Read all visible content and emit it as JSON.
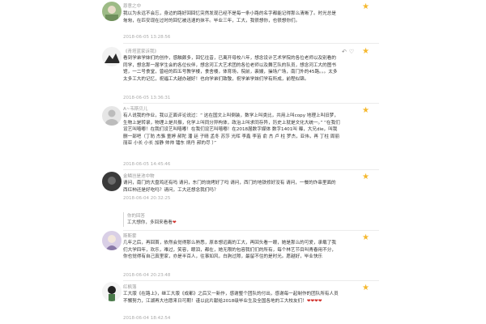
{
  "comments": [
    {
      "user": "恩意之中",
      "text": "我以为永远不会忘，身边的路好回回忆突然发现已经不是每一条小路的名字都能记得那么清晰了。时光总是匆匆，在匹安现在过时的回忆被迅速的抹平。毕业三年，工大，我很想你，也很想你们。",
      "time": "2018-06-05 13:28:56"
    },
    {
      "user": "《青塔蓝家诉我》",
      "text": "看到学弟学妹们的创作，感触颇多，回忆往昔，已离开母校八年，想念设计艺术学院的各位老师以及别看的同学，想念那一届学生会的各位伙伴，想念河工大艺术团的各位老师以及舞艺队的队员，想念河工大的图书馆，一二号食堂，曾经的四五号教学楼，食舍楼，体育场，院前，裴嫂，操场广场，南门外的45路。。。太多太多工大的记忆，祝福工大越办越好！也向学弟们致敬，祝学弟学妹们学有所成，前程似锦。",
      "time": "2018-06-05 13:36:31"
    },
    {
      "user": "A~韦斯贝儿",
      "text": "有人说我的作业，我以正面评论说过：“ 这在国文上叫倒装，数学上叫类比，共用上叫copy 地理上叫旧梦，生物上是转录，物理上是共振，化学上叫同分异构体，政治上叫求同存异，历史上就是文化大统一。” “在我们设艺叫嘻嘟！在我们设艺叫嘻嘟！在我们设艺叫嘻嘟！在2018届数字媒体 数字1401叫 曝，大兄die，叫我删一部吧（丁昉 杰骆 童婷 郝陀 潘 廷 子晴 孟冬 苏莎 光晖 李鑫 李苗 俞 杰 卢 柱 罗杰，亚伟，再 丁柱 周丽 丽亚 小长 小长 加静 帅帅 镭东 炳丹 郝的尽 ）”",
      "time": "2018-06-05 14:45:46"
    },
    {
      "user": "金鳞岂是池中物",
      "text": "请问，南门的大盘鸡还有吗 请问，东门的烧烤好了吗 请问，西门的地铁修好没有 请问，一餐的炸串里面的西红柿还是好吃吗？请问，工大还想念我们吗？",
      "time": "2018-06-04 20:32:25",
      "reply_name": "你的回答",
      "reply_text": "工大想你，多回来看看",
      "reply_heart": "❤"
    },
    {
      "user": "斯斯雾",
      "text": "几年之后，再回首，依然会觉得那么熟悉，原本想远离的工大，再回头看一眼，她是那么的可爱，承载了我们大学四年，欢乐，难过，笑容，眼泪，都在，她无限的包容我们们的所有，每个林艺节目叫青春用不分，你也觉得有自己真里家，亦是半百人，往事如风，白驹过隙，最留不住的是时光。愿越好，毕业快乐",
      "time": "2018-06-04 20:23:48"
    },
    {
      "user": "红枫落",
      "text": "工大版《在路上》，继工大版《成都》之后又一新作，感谢整个团队的付出，感谢每一起制作的团队所有人员不懈努力，江湖再大也愿来日可期！谨以此片献给2018级毕业生及全国各地的工大校友们！",
      "hearts": "❤❤❤❤",
      "time": "2018-06-04 18:42:54"
    }
  ],
  "actions": {
    "reply": "↶",
    "like": "♡"
  },
  "star_icon": "★",
  "colors": {
    "star": "#f5b82e",
    "heart": "#d0302b",
    "time": "#aaaaaa",
    "divider": "#ececec"
  }
}
